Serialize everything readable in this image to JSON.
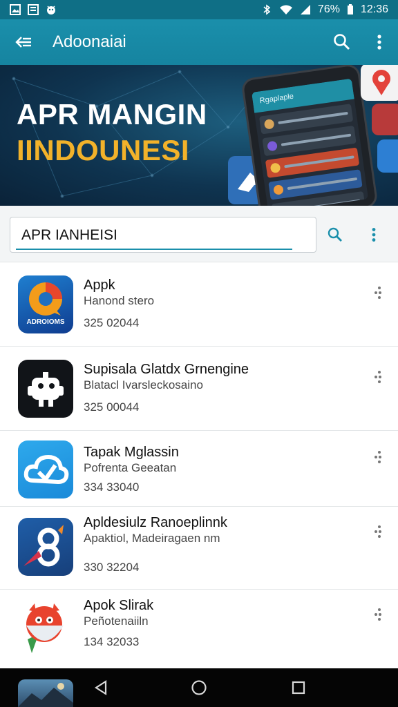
{
  "status_bar": {
    "battery": "76%",
    "time": "12:36",
    "icons": [
      "photo-icon",
      "notification-icon",
      "android-icon",
      "bluetooth-icon",
      "wifi-icon",
      "signal-icon",
      "battery-icon"
    ]
  },
  "app_bar": {
    "title": "Adoonaiai",
    "icons": [
      "back-arrow-icon",
      "search-icon",
      "more-vert-icon"
    ]
  },
  "banner": {
    "line1": "APR MANGIN",
    "line2": "IINDOUNESI",
    "phone_header": "Rgaplaple",
    "colors": {
      "line1": "#ffffff",
      "line2": "#f2b22a"
    }
  },
  "search": {
    "value": "APR IANHEISI",
    "icons": [
      "search-icon",
      "more-vert-icon"
    ]
  },
  "apps": [
    {
      "name": "Appk",
      "desc": "Hanond stero",
      "meta": "325 02044",
      "icon_label": "ADROIOMS"
    },
    {
      "name": "Supisala Glatdx Grnengine",
      "desc": "Blatacl Ivarsleckosaino",
      "meta": "325 00044"
    },
    {
      "name": "Tapak Mglassin",
      "desc": "Pofrenta  Geeatan",
      "meta": "334 33040"
    },
    {
      "name": "Apldesiulz Ranoeplinnk",
      "desc": "Apaktiol, Madeiragaen nm",
      "meta": "330 32204"
    },
    {
      "name": "Apok Slirak",
      "desc": "Peñotenaiiln",
      "meta": "134 32033"
    }
  ],
  "accent": "#1a8fab",
  "nav_icons": [
    "back-triangle-icon",
    "home-circle-icon",
    "recents-square-icon"
  ]
}
